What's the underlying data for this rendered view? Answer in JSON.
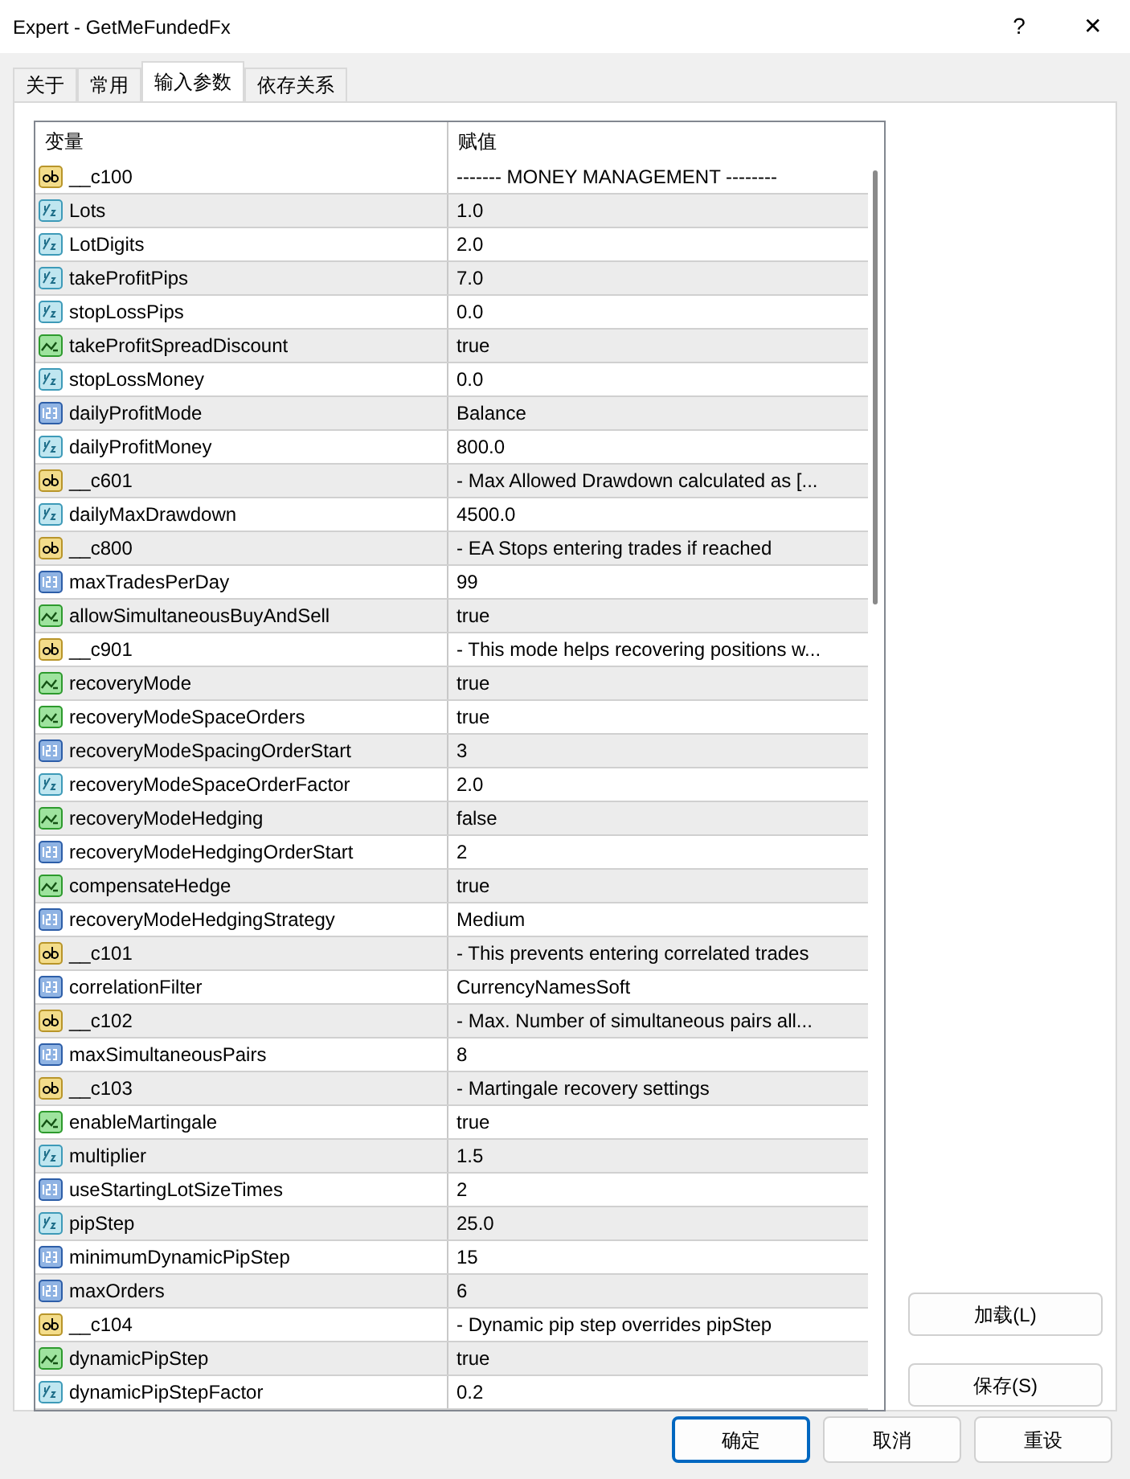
{
  "window": {
    "title": "Expert - GetMeFundedFx",
    "help": "?",
    "close": "✕"
  },
  "tabs": [
    {
      "label": "关于",
      "selected": false
    },
    {
      "label": "常用",
      "selected": false
    },
    {
      "label": "输入参数",
      "selected": true
    },
    {
      "label": "依存关系",
      "selected": false
    }
  ],
  "table": {
    "columns": [
      "变量",
      "赋值"
    ],
    "rows": [
      {
        "kind": "string",
        "name": "__c100",
        "value": "------- MONEY MANAGEMENT --------"
      },
      {
        "kind": "double",
        "name": "Lots",
        "value": "1.0"
      },
      {
        "kind": "double",
        "name": "LotDigits",
        "value": "2.0"
      },
      {
        "kind": "double",
        "name": "takeProfitPips",
        "value": "7.0"
      },
      {
        "kind": "double",
        "name": "stopLossPips",
        "value": "0.0"
      },
      {
        "kind": "bool",
        "name": "takeProfitSpreadDiscount",
        "value": "true"
      },
      {
        "kind": "double",
        "name": "stopLossMoney",
        "value": "0.0"
      },
      {
        "kind": "int",
        "name": "dailyProfitMode",
        "value": "Balance"
      },
      {
        "kind": "double",
        "name": "dailyProfitMoney",
        "value": "800.0"
      },
      {
        "kind": "string",
        "name": "__c601",
        "value": "- Max Allowed Drawdown calculated as [..."
      },
      {
        "kind": "double",
        "name": "dailyMaxDrawdown",
        "value": "4500.0"
      },
      {
        "kind": "string",
        "name": "__c800",
        "value": "- EA Stops entering trades if reached"
      },
      {
        "kind": "int",
        "name": "maxTradesPerDay",
        "value": "99"
      },
      {
        "kind": "bool",
        "name": "allowSimultaneousBuyAndSell",
        "value": "true"
      },
      {
        "kind": "string",
        "name": "__c901",
        "value": "- This mode helps recovering positions w..."
      },
      {
        "kind": "bool",
        "name": "recoveryMode",
        "value": "true"
      },
      {
        "kind": "bool",
        "name": "recoveryModeSpaceOrders",
        "value": "true"
      },
      {
        "kind": "int",
        "name": "recoveryModeSpacingOrderStart",
        "value": "3"
      },
      {
        "kind": "double",
        "name": "recoveryModeSpaceOrderFactor",
        "value": "2.0"
      },
      {
        "kind": "bool",
        "name": "recoveryModeHedging",
        "value": "false"
      },
      {
        "kind": "int",
        "name": "recoveryModeHedgingOrderStart",
        "value": "2"
      },
      {
        "kind": "bool",
        "name": "compensateHedge",
        "value": "true"
      },
      {
        "kind": "int",
        "name": "recoveryModeHedgingStrategy",
        "value": "Medium"
      },
      {
        "kind": "string",
        "name": "__c101",
        "value": "- This prevents entering correlated trades"
      },
      {
        "kind": "int",
        "name": "correlationFilter",
        "value": "CurrencyNamesSoft"
      },
      {
        "kind": "string",
        "name": "__c102",
        "value": "- Max. Number of simultaneous pairs all..."
      },
      {
        "kind": "int",
        "name": "maxSimultaneousPairs",
        "value": "8"
      },
      {
        "kind": "string",
        "name": "__c103",
        "value": "- Martingale recovery settings"
      },
      {
        "kind": "bool",
        "name": "enableMartingale",
        "value": "true"
      },
      {
        "kind": "double",
        "name": "multiplier",
        "value": "1.5"
      },
      {
        "kind": "int",
        "name": "useStartingLotSizeTimes",
        "value": "2"
      },
      {
        "kind": "double",
        "name": "pipStep",
        "value": "25.0"
      },
      {
        "kind": "int",
        "name": "minimumDynamicPipStep",
        "value": "15"
      },
      {
        "kind": "int",
        "name": "maxOrders",
        "value": "6"
      },
      {
        "kind": "string",
        "name": "__c104",
        "value": "- Dynamic pip step overrides pipStep"
      },
      {
        "kind": "bool",
        "name": "dynamicPipStep",
        "value": "true"
      },
      {
        "kind": "double",
        "name": "dynamicPipStepFactor",
        "value": "0.2"
      }
    ]
  },
  "side_buttons": [
    "加载(L)",
    "保存(S)"
  ],
  "bottom_buttons": [
    {
      "label": "确定",
      "default": true
    },
    {
      "label": "取消",
      "default": false
    },
    {
      "label": "重设",
      "default": false
    }
  ]
}
